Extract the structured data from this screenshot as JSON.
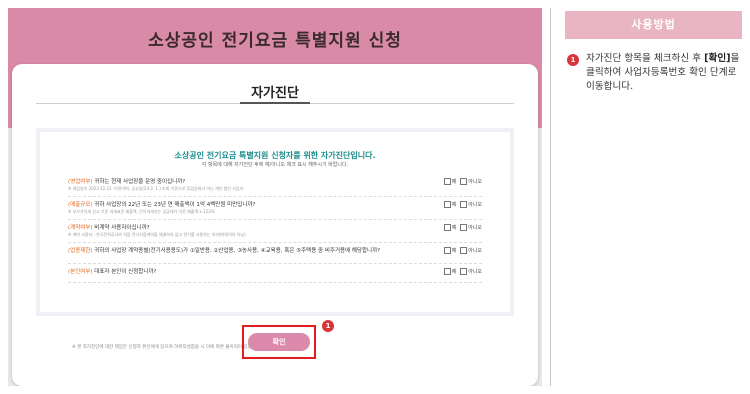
{
  "page": {
    "header_title": "소상공인 전기요금 특별지원 신청",
    "card_title": "자가진단",
    "intro": "소상공인 전기요금 특별지원 신청자를 위한 자가진단입니다.",
    "intro_sub": "각 항목에 대해 자가진단 후에 예/아니오 체크 표시 해주시기 바랍니다.",
    "options": {
      "yes": "예",
      "no": "아니오"
    },
    "questions": [
      {
        "tag": "(영업여부)",
        "text": " 귀하는 현재 사업장을 운영 중이십니까?",
        "note": "※ 개업일이 2023.12.31. 이전이며, 공고일(24.3. 1.) 조회 기준으로 휴업상태가 아닌 개인·법인 사업자"
      },
      {
        "tag": "(매출규모)",
        "text": " 귀하 사업장의 22년 또는 23년 연 매출액이 1억 4백만원 미만입니까?",
        "note": "※ 부가가치세 신고 기준 과세표준 매출액, 간이과세자는 공급대가 기준 매출액 x 123%"
      },
      {
        "tag": "(계약여부)",
        "text": " 비계약 사용자이십니까?",
        "note": "※ 계약 사용자 : 한국전력공사와 직접 전기사용계약을 체결하지 않고 전기를 사용하는 자(계약명의자 아님)"
      },
      {
        "tag": "(업종제한)",
        "text": " 귀하의 사업장 계약종별(전기사용용도)가 ①일반용, ②산업용, ③농사용, ④교육용, 혹은 ⑤주택용 중 비주거용에 해당합니까?",
        "note": ""
      },
      {
        "tag": "(본인여부)",
        "text": " 대표자 본인이 신청합니까?",
        "note": ""
      }
    ],
    "footnote": "※ 본 자가진단에 대한 책임은 신청자 본인에게 있으며 허위작성함을 시 이에 따른 불이익이 있을 수 있습니다.(공고문 참조)",
    "confirm_label": "확인",
    "badge": "1"
  },
  "help": {
    "title": "사용방법",
    "step_badge": "1",
    "step_pre": "자가진단 항목을 체크하신 후 ",
    "step_bold": "[확인]",
    "step_post": "을 클릭하여 사업자등록번호 확인 단계로 이동합니다."
  },
  "colors": {
    "header": "#d98aa6",
    "help_header": "#eab5c2",
    "confirm_button": "#db8aab",
    "highlight": "#e31c1c",
    "intro_text": "#1c8c8c",
    "tag_text": "#e0661f"
  },
  "icons": [
    "checkbox-icon",
    "step-number-badge"
  ]
}
